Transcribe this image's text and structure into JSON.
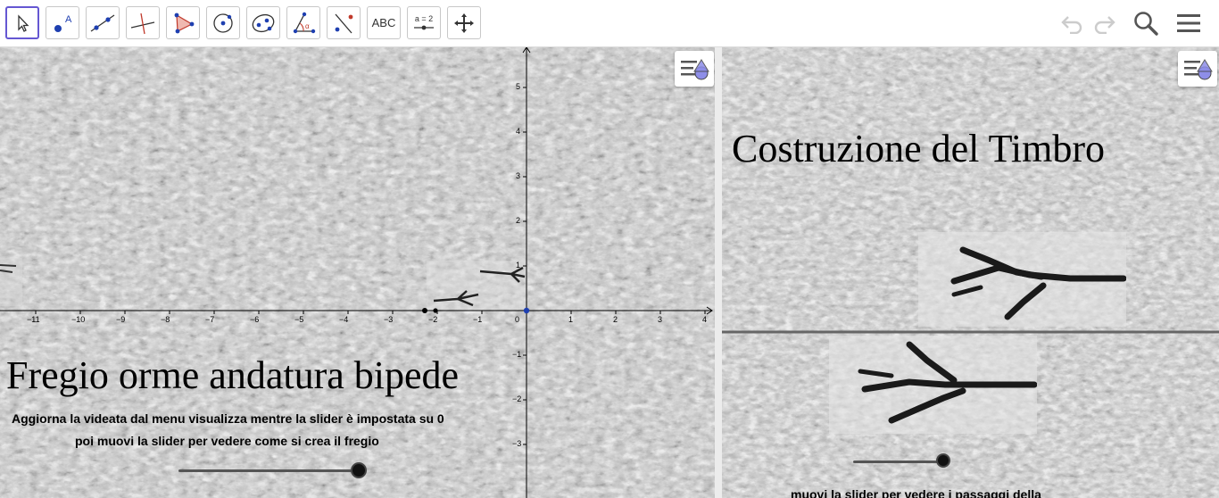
{
  "toolbar": {
    "tools": [
      {
        "name": "move-tool",
        "label": ""
      },
      {
        "name": "point-tool",
        "label": ""
      },
      {
        "name": "line-tool",
        "label": ""
      },
      {
        "name": "perpendicular-line-tool",
        "label": ""
      },
      {
        "name": "polygon-tool",
        "label": ""
      },
      {
        "name": "circle-center-point-tool",
        "label": ""
      },
      {
        "name": "conic-ellipse-tool",
        "label": ""
      },
      {
        "name": "angle-tool",
        "label": ""
      },
      {
        "name": "reflect-tool",
        "label": ""
      },
      {
        "name": "text-tool",
        "label": "ABC"
      },
      {
        "name": "slider-tool",
        "label": "a = 2"
      },
      {
        "name": "move-graphics-view-tool",
        "label": ""
      }
    ],
    "right_controls": [
      "undo-icon",
      "redo-icon",
      "search-icon",
      "menu-icon"
    ]
  },
  "left_view": {
    "title": "Fregio orme andatura bipede",
    "instruction_line1": "Aggiorna  la videata dal menu visualizza mentre la slider è impostata su 0",
    "instruction_line2": "poi muovi la slider per vedere come si crea il fregio",
    "x_ticks": [
      "−11",
      "−10",
      "−9",
      "−8",
      "−7",
      "−6",
      "−5",
      "−4",
      "−3",
      "−2",
      "−1",
      "0",
      "1",
      "2",
      "3",
      "4"
    ],
    "y_ticks": [
      "5",
      "4",
      "3",
      "2",
      "1",
      "−1",
      "−2",
      "−3"
    ],
    "slider_value_fraction": 1.0
  },
  "right_view": {
    "title": "Costruzione del Timbro",
    "bottom_text": "muovi la slider per vedere i passaggi della",
    "slider_value_fraction": 1.0
  },
  "colors": {
    "accent": "#6557d2",
    "axis": "#000000",
    "slider_track": "#555555",
    "texture": "#c4c4c4"
  }
}
